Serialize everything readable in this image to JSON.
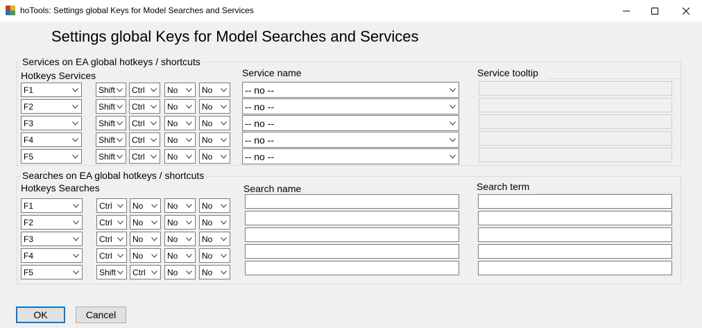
{
  "window": {
    "title": "hoTools: Settings global Keys for Model Searches and Services",
    "icons": [
      "app-icon",
      "minimize-icon",
      "maximize-icon",
      "close-icon"
    ]
  },
  "heading": "Settings global Keys for Model Searches and Services",
  "services": {
    "group_title": "Services on EA global hotkeys / shortcuts",
    "hotkeys_label": "Hotkeys Services",
    "name_label": "Service name",
    "tooltip_label": "Service tooltip",
    "rows": [
      {
        "key": "F1",
        "mod1": "Shift",
        "mod2": "Ctrl",
        "mod3": "No",
        "mod4": "No",
        "name": "-- no --",
        "tooltip": ""
      },
      {
        "key": "F2",
        "mod1": "Shift",
        "mod2": "Ctrl",
        "mod3": "No",
        "mod4": "No",
        "name": "-- no --",
        "tooltip": ""
      },
      {
        "key": "F3",
        "mod1": "Shift",
        "mod2": "Ctrl",
        "mod3": "No",
        "mod4": "No",
        "name": "-- no --",
        "tooltip": ""
      },
      {
        "key": "F4",
        "mod1": "Shift",
        "mod2": "Ctrl",
        "mod3": "No",
        "mod4": "No",
        "name": "-- no --",
        "tooltip": ""
      },
      {
        "key": "F5",
        "mod1": "Shift",
        "mod2": "Ctrl",
        "mod3": "No",
        "mod4": "No",
        "name": "-- no --",
        "tooltip": ""
      }
    ]
  },
  "searches": {
    "group_title": "Searches on EA global hotkeys / shortcuts",
    "hotkeys_label": "Hotkeys Searches",
    "name_label": "Search name",
    "term_label": "Search term",
    "rows": [
      {
        "key": "F1",
        "mod1": "Ctrl",
        "mod2": "No",
        "mod3": "No",
        "mod4": "No",
        "name": "",
        "term": ""
      },
      {
        "key": "F2",
        "mod1": "Ctrl",
        "mod2": "No",
        "mod3": "No",
        "mod4": "No",
        "name": "",
        "term": ""
      },
      {
        "key": "F3",
        "mod1": "Ctrl",
        "mod2": "No",
        "mod3": "No",
        "mod4": "No",
        "name": "",
        "term": ""
      },
      {
        "key": "F4",
        "mod1": "Ctrl",
        "mod2": "No",
        "mod3": "No",
        "mod4": "No",
        "name": "",
        "term": ""
      },
      {
        "key": "F5",
        "mod1": "Shift",
        "mod2": "Ctrl",
        "mod3": "No",
        "mod4": "No",
        "name": "",
        "term": ""
      }
    ]
  },
  "buttons": {
    "ok": "OK",
    "cancel": "Cancel"
  },
  "colors": {
    "window_bg": "#f0f0f0",
    "titlebar_bg": "#ffffff",
    "default_button_border": "#0078d7"
  }
}
